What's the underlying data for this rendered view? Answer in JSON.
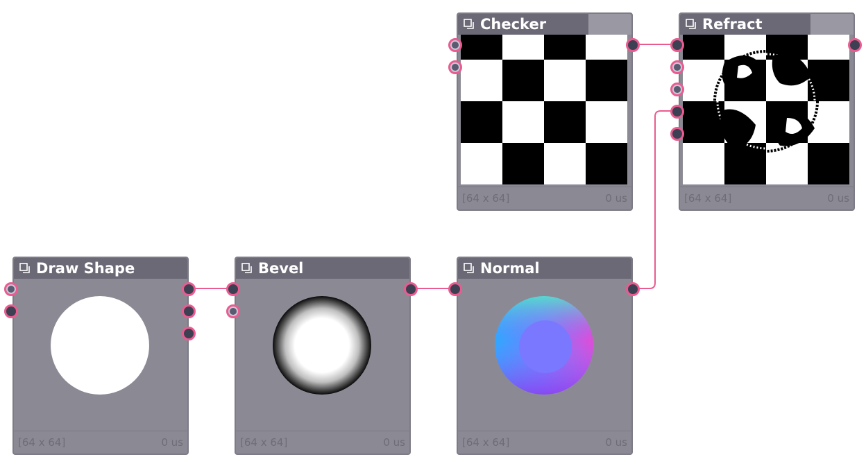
{
  "nodes": {
    "checker": {
      "title": "Checker",
      "size": "[64 x 64]",
      "time": "0 us"
    },
    "refract": {
      "title": "Refract",
      "size": "[64 x 64]",
      "time": "0 us"
    },
    "draw_shape": {
      "title": "Draw Shape",
      "size": "[64 x 64]",
      "time": "0 us"
    },
    "bevel": {
      "title": "Bevel",
      "size": "[64 x 64]",
      "time": "0 us"
    },
    "normal": {
      "title": "Normal",
      "size": "[64 x 64]",
      "time": "0 us"
    }
  },
  "colors": {
    "wire": "#ea5b8f",
    "node_body": "#8b8a94",
    "node_header": "#6a6975",
    "port_fill": "#3d3f52"
  },
  "icons": {
    "node_header": "copy-icon"
  }
}
